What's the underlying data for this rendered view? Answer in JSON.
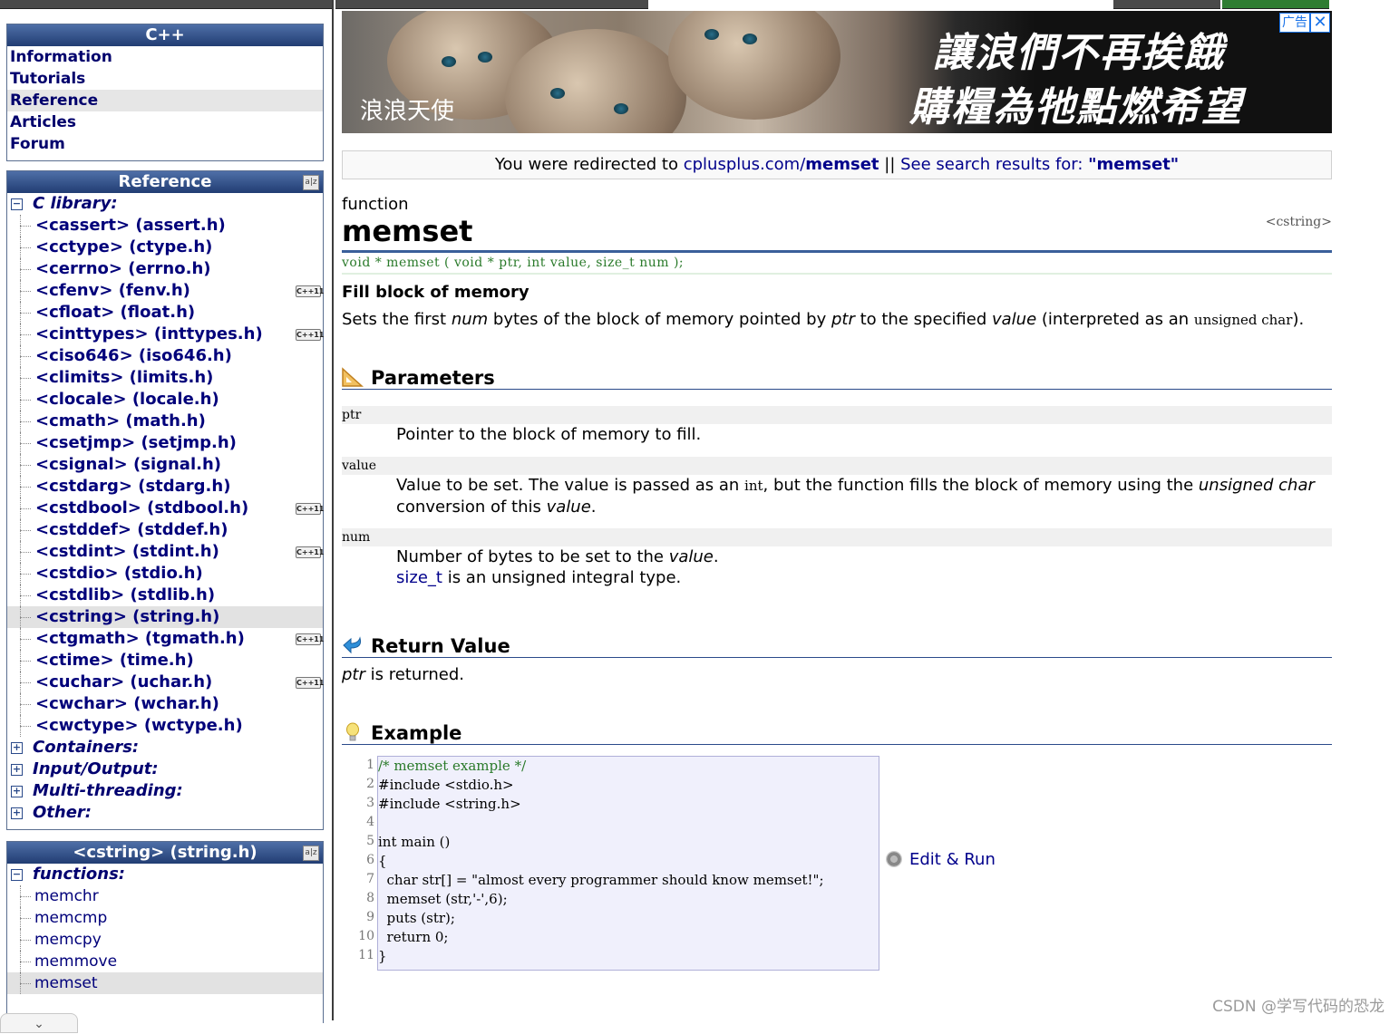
{
  "colors": {
    "accent": "#213d73",
    "link": "#00008b",
    "proto": "#2a7a2a",
    "code_bg": "#f0f0fc"
  },
  "left": {
    "cpp_box": {
      "title": "C++",
      "items": [
        {
          "label": "Information"
        },
        {
          "label": "Tutorials"
        },
        {
          "label": "Reference",
          "selected": true
        },
        {
          "label": "Articles"
        },
        {
          "label": "Forum"
        }
      ]
    },
    "ref_box": {
      "title": "Reference",
      "title_icon": "book-icon",
      "category": "C library:",
      "headers": [
        {
          "label": "<cassert> (assert.h)"
        },
        {
          "label": "<cctype> (ctype.h)"
        },
        {
          "label": "<cerrno> (errno.h)"
        },
        {
          "label": "<cfenv> (fenv.h)",
          "badge": "C++11"
        },
        {
          "label": "<cfloat> (float.h)"
        },
        {
          "label": "<cinttypes> (inttypes.h)",
          "badge": "C++11"
        },
        {
          "label": "<ciso646> (iso646.h)"
        },
        {
          "label": "<climits> (limits.h)"
        },
        {
          "label": "<clocale> (locale.h)"
        },
        {
          "label": "<cmath> (math.h)"
        },
        {
          "label": "<csetjmp> (setjmp.h)"
        },
        {
          "label": "<csignal> (signal.h)"
        },
        {
          "label": "<cstdarg> (stdarg.h)"
        },
        {
          "label": "<cstdbool> (stdbool.h)",
          "badge": "C++11"
        },
        {
          "label": "<cstddef> (stddef.h)"
        },
        {
          "label": "<cstdint> (stdint.h)",
          "badge": "C++11"
        },
        {
          "label": "<cstdio> (stdio.h)"
        },
        {
          "label": "<cstdlib> (stdlib.h)"
        },
        {
          "label": "<cstring> (string.h)",
          "selected": true
        },
        {
          "label": "<ctgmath> (tgmath.h)",
          "badge": "C++11"
        },
        {
          "label": "<ctime> (time.h)"
        },
        {
          "label": "<cuchar> (uchar.h)",
          "badge": "C++11"
        },
        {
          "label": "<cwchar> (wchar.h)"
        },
        {
          "label": "<cwctype> (wctype.h)"
        }
      ],
      "collapsed": [
        {
          "label": "Containers:"
        },
        {
          "label": "Input/Output:"
        },
        {
          "label": "Multi-threading:"
        },
        {
          "label": "Other:"
        }
      ]
    },
    "cstring_box": {
      "title": "<cstring> (string.h)",
      "title_icon": "book-icon",
      "category": "functions:",
      "functions": [
        {
          "label": "memchr"
        },
        {
          "label": "memcmp"
        },
        {
          "label": "memcpy"
        },
        {
          "label": "memmove"
        },
        {
          "label": "memset",
          "selected": true
        }
      ]
    },
    "bottom_tab_icon": "chevron-down-icon"
  },
  "ad": {
    "logo": "浪浪天使",
    "slogan_line1": "讓浪們不再挨餓",
    "slogan_line2": "購糧為牠點燃希望",
    "ad_label": "广告",
    "close_icon": "close-icon"
  },
  "redirect": {
    "prefix": "You were redirected to ",
    "site": "cplusplus.com/",
    "target": "memset",
    "separator": " || ",
    "search_prefix": "See search results for: ",
    "search_term": "\"memset\""
  },
  "page": {
    "kind": "function",
    "name": "memset",
    "header": "<cstring>",
    "prototype": "void * memset ( void * ptr, int value, size_t num );",
    "short_desc": "Fill block of memory",
    "desc": {
      "p1": "Sets the first ",
      "num": "num",
      "p2": " bytes of the block of memory pointed by ",
      "ptr": "ptr",
      "p3": " to the specified ",
      "value": "value",
      "p4": " (interpreted as an ",
      "type": "unsigned char",
      "p5": ")."
    }
  },
  "parameters": {
    "title": "Parameters",
    "icon": "triangle-ruler-icon",
    "ptr": {
      "key": "ptr",
      "text": "Pointer to the block of memory to fill."
    },
    "value": {
      "key": "value",
      "t1": "Value to be set. The value is passed as an ",
      "int": "int",
      "t2": ", but the function fills the block of memory using the ",
      "uc": "unsigned char",
      "t3": "conversion of this ",
      "v": "value",
      "t4": "."
    },
    "num": {
      "key": "num",
      "t1": "Number of bytes to be set to the ",
      "v": "value",
      "t2": ".",
      "size_t": "size_t",
      "t3": " is an unsigned integral type."
    }
  },
  "return_value": {
    "title": "Return Value",
    "icon": "return-arrow-icon",
    "ptr": "ptr",
    "text": " is returned."
  },
  "example": {
    "title": "Example",
    "icon": "lightbulb-icon",
    "line_numbers": [
      "1",
      "2",
      "3",
      "4",
      "5",
      "6",
      "7",
      "8",
      "9",
      "10",
      "11"
    ],
    "code": [
      "/* memset example */",
      "#include <stdio.h>",
      "#include <string.h>",
      "",
      "int main ()",
      "{",
      "  char str[] = \"almost every programmer should know memset!\";",
      "  memset (str,'-',6);",
      "  puts (str);",
      "  return 0;",
      "}"
    ],
    "edit_run": "Edit & Run",
    "edit_icon": "gear-icon"
  },
  "watermark": "CSDN @学写代码的恐龙"
}
